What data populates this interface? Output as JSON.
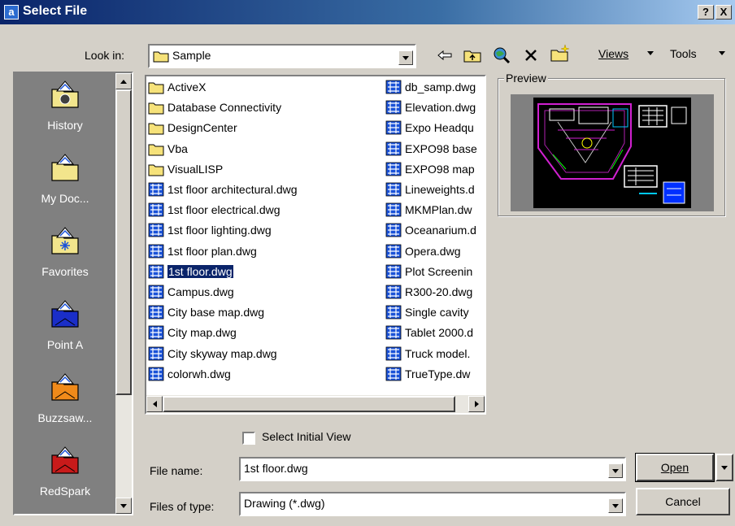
{
  "window": {
    "title": "Select File",
    "help_label": "?",
    "close_label": "X"
  },
  "look_in": {
    "label": "Look in:",
    "value": "Sample"
  },
  "toolbar": {
    "views_label": "Views",
    "tools_label": "Tools",
    "icons": [
      "back-arrow-icon",
      "up-folder-icon",
      "search-web-icon",
      "delete-icon",
      "create-folder-icon"
    ]
  },
  "places": [
    {
      "label": "History",
      "icon": "history-folder-icon",
      "color": "#f2e58c"
    },
    {
      "label": "My Doc...",
      "icon": "my-documents-folder-icon",
      "color": "#f2e58c"
    },
    {
      "label": "Favorites",
      "icon": "favorites-folder-icon",
      "color": "#f2e58c"
    },
    {
      "label": "Point A",
      "icon": "point-a-folder-icon",
      "color": "#1a2ec8"
    },
    {
      "label": "Buzzsaw...",
      "icon": "buzzsaw-folder-icon",
      "color": "#f08a1a"
    },
    {
      "label": "RedSpark",
      "icon": "redspark-folder-icon",
      "color": "#c81a1a"
    }
  ],
  "files_col1": [
    {
      "name": "ActiveX",
      "type": "folder"
    },
    {
      "name": "Database Connectivity",
      "type": "folder"
    },
    {
      "name": "DesignCenter",
      "type": "folder"
    },
    {
      "name": "Vba",
      "type": "folder"
    },
    {
      "name": "VisualLISP",
      "type": "folder"
    },
    {
      "name": "1st floor architectural.dwg",
      "type": "dwg"
    },
    {
      "name": "1st floor electrical.dwg",
      "type": "dwg"
    },
    {
      "name": "1st floor lighting.dwg",
      "type": "dwg"
    },
    {
      "name": "1st floor plan.dwg",
      "type": "dwg"
    },
    {
      "name": "1st floor.dwg",
      "type": "dwg",
      "selected": true
    },
    {
      "name": "Campus.dwg",
      "type": "dwg"
    },
    {
      "name": "City base map.dwg",
      "type": "dwg"
    },
    {
      "name": "City map.dwg",
      "type": "dwg"
    },
    {
      "name": "City skyway map.dwg",
      "type": "dwg"
    },
    {
      "name": "colorwh.dwg",
      "type": "dwg"
    }
  ],
  "files_col2": [
    {
      "name": "db_samp.dwg",
      "type": "dwg"
    },
    {
      "name": "Elevation.dwg",
      "type": "dwg"
    },
    {
      "name": "Expo Headqu",
      "type": "dwg"
    },
    {
      "name": "EXPO98 base",
      "type": "dwg"
    },
    {
      "name": "EXPO98 map",
      "type": "dwg"
    },
    {
      "name": "Lineweights.d",
      "type": "dwg"
    },
    {
      "name": "MKMPlan.dw",
      "type": "dwg"
    },
    {
      "name": "Oceanarium.d",
      "type": "dwg"
    },
    {
      "name": "Opera.dwg",
      "type": "dwg"
    },
    {
      "name": "Plot Screenin",
      "type": "dwg"
    },
    {
      "name": "R300-20.dwg",
      "type": "dwg"
    },
    {
      "name": "Single cavity",
      "type": "dwg"
    },
    {
      "name": "Tablet 2000.d",
      "type": "dwg"
    },
    {
      "name": "Truck model.",
      "type": "dwg"
    },
    {
      "name": "TrueType.dw",
      "type": "dwg"
    }
  ],
  "preview": {
    "label": "Preview"
  },
  "select_initial_view": {
    "label": "Select Initial View",
    "checked": false
  },
  "file_name": {
    "label": "File name:",
    "value": "1st floor.dwg"
  },
  "files_of_type": {
    "label": "Files of type:",
    "value": "Drawing (*.dwg)"
  },
  "buttons": {
    "open_label": "Open",
    "cancel_label": "Cancel"
  },
  "colors": {
    "selection": "#0a246a",
    "folder": "#f6e27a",
    "dwg_icon": "#1a52d8"
  }
}
